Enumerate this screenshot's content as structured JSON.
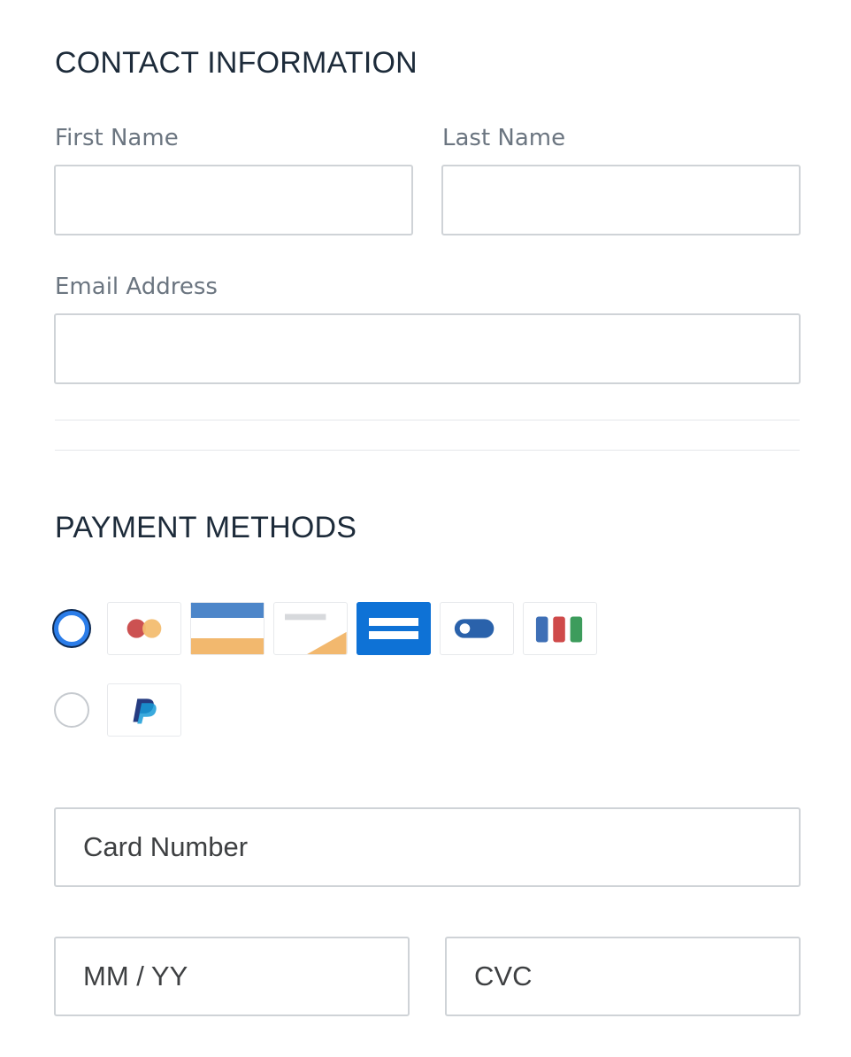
{
  "contact": {
    "title": "CONTACT INFORMATION",
    "first_name_label": "First Name",
    "last_name_label": "Last Name",
    "email_label": "Email Address",
    "first_name_value": "",
    "last_name_value": "",
    "email_value": ""
  },
  "payment": {
    "title": "PAYMENT METHODS",
    "options": [
      {
        "selected": true,
        "icons": [
          "mastercard-icon",
          "card-stripe-blue-orange-icon",
          "card-gray-orange-icon",
          "card-blue-bars-icon",
          "card-toggle-icon",
          "jcb-icon"
        ]
      },
      {
        "selected": false,
        "icons": [
          "paypal-icon"
        ]
      }
    ],
    "card_number_placeholder": "Card Number",
    "expiry_placeholder": "MM / YY",
    "cvc_placeholder": "CVC"
  },
  "colors": {
    "accent": "#2b7de9",
    "title": "#1d2b3a",
    "label": "#6b7580",
    "border": "#cfd3d7"
  }
}
